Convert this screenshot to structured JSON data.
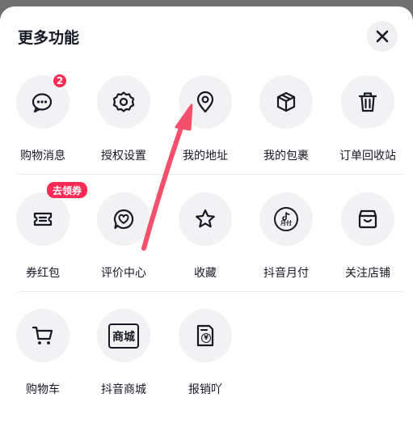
{
  "panel": {
    "title": "更多功能",
    "close_icon": "close-icon"
  },
  "rows": [
    {
      "items": [
        {
          "label": "购物消息",
          "icon": "chat-bubbles-icon",
          "badge": "2"
        },
        {
          "label": "授权设置",
          "icon": "gear-icon"
        },
        {
          "label": "我的地址",
          "icon": "location-pin-icon"
        },
        {
          "label": "我的包裹",
          "icon": "package-box-icon"
        },
        {
          "label": "订单回收站",
          "icon": "trash-bin-icon"
        }
      ]
    },
    {
      "items": [
        {
          "label": "券红包",
          "icon": "coupon-icon",
          "badge": "去领券"
        },
        {
          "label": "评价中心",
          "icon": "heart-bubble-icon"
        },
        {
          "label": "收藏",
          "icon": "star-icon"
        },
        {
          "label": "抖音月付",
          "icon": "douyin-monthly-pay-icon",
          "icon_text": "月付"
        },
        {
          "label": "关注店铺",
          "icon": "storefront-icon"
        }
      ]
    },
    {
      "items": [
        {
          "label": "购物车",
          "icon": "shopping-cart-icon"
        },
        {
          "label": "抖音商城",
          "icon": "mall-icon",
          "icon_text": "商城"
        },
        {
          "label": "报销吖",
          "icon": "receipt-yen-icon",
          "icon_text": "¥"
        }
      ]
    }
  ],
  "colors": {
    "accent": "#fe2c55",
    "icon_bg": "#f2f2f4",
    "text": "#161823",
    "overlay": "#6f6f6f"
  },
  "annotation": {
    "icon": "red-arrow-pointer"
  }
}
